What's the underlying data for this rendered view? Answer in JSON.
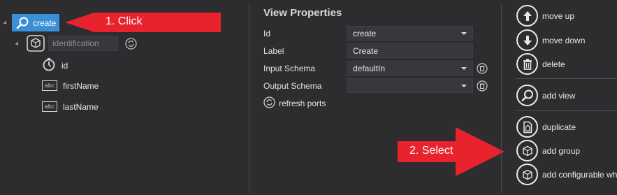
{
  "tree": {
    "root_label": "create",
    "group_placeholder": "identification",
    "fields": [
      {
        "label": "id",
        "icon": "stopwatch-icon"
      },
      {
        "label": "firstName",
        "icon": "text-field-icon"
      },
      {
        "label": "lastName",
        "icon": "text-field-icon"
      }
    ],
    "text_field_glyph": "abc"
  },
  "annotations": {
    "step1": "1. Click",
    "step2": "2. Select",
    "arrow_color": "#e8232d"
  },
  "properties": {
    "title": "View Properties",
    "id_label": "Id",
    "id_value": "create",
    "label_label": "Label",
    "label_value": "Create",
    "input_schema_label": "Input Schema",
    "input_schema_value": "defaultIn",
    "output_schema_label": "Output Schema",
    "output_schema_value": "",
    "refresh_ports": "refresh ports"
  },
  "actions": {
    "move_up": "move up",
    "move_down": "move down",
    "delete": "delete",
    "add_view": "add view",
    "duplicate": "duplicate",
    "add_group": "add group",
    "add_configurable": "add configurable wh"
  },
  "colors": {
    "selection": "#3a8fd6",
    "background": "#2d2d30"
  }
}
